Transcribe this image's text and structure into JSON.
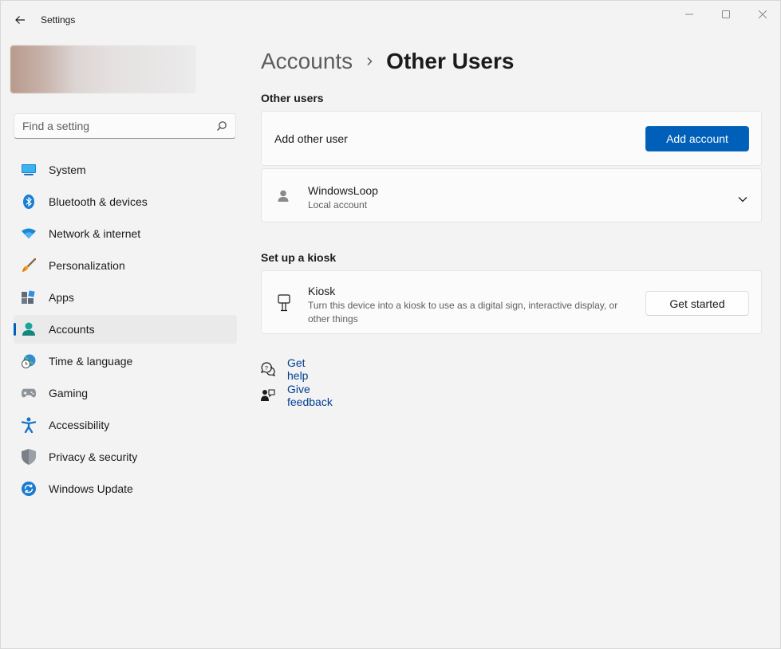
{
  "window": {
    "title": "Settings"
  },
  "search": {
    "placeholder": "Find a setting"
  },
  "sidebar": {
    "items": [
      {
        "label": "System",
        "icon": "system-icon"
      },
      {
        "label": "Bluetooth & devices",
        "icon": "bluetooth-icon"
      },
      {
        "label": "Network & internet",
        "icon": "network-icon"
      },
      {
        "label": "Personalization",
        "icon": "personalization-icon"
      },
      {
        "label": "Apps",
        "icon": "apps-icon"
      },
      {
        "label": "Accounts",
        "icon": "accounts-icon",
        "active": true
      },
      {
        "label": "Time & language",
        "icon": "time-language-icon"
      },
      {
        "label": "Gaming",
        "icon": "gaming-icon"
      },
      {
        "label": "Accessibility",
        "icon": "accessibility-icon"
      },
      {
        "label": "Privacy & security",
        "icon": "privacy-icon"
      },
      {
        "label": "Windows Update",
        "icon": "windows-update-icon"
      }
    ]
  },
  "breadcrumb": {
    "parent": "Accounts",
    "current": "Other Users"
  },
  "other_users": {
    "title": "Other users",
    "add_user_label": "Add other user",
    "add_button": "Add account",
    "user": {
      "name": "WindowsLoop",
      "type": "Local account"
    }
  },
  "kiosk": {
    "title": "Set up a kiosk",
    "name": "Kiosk",
    "description_line1": "Turn this device into a kiosk to use as a digital sign, interactive display, or",
    "description_line2": "other things",
    "button": "Get started"
  },
  "links": {
    "help": "Get help",
    "feedback": "Give feedback"
  },
  "colors": {
    "accent": "#005fb8",
    "background": "#f3f3f3",
    "card": "#fbfbfb",
    "link": "#003e92"
  }
}
